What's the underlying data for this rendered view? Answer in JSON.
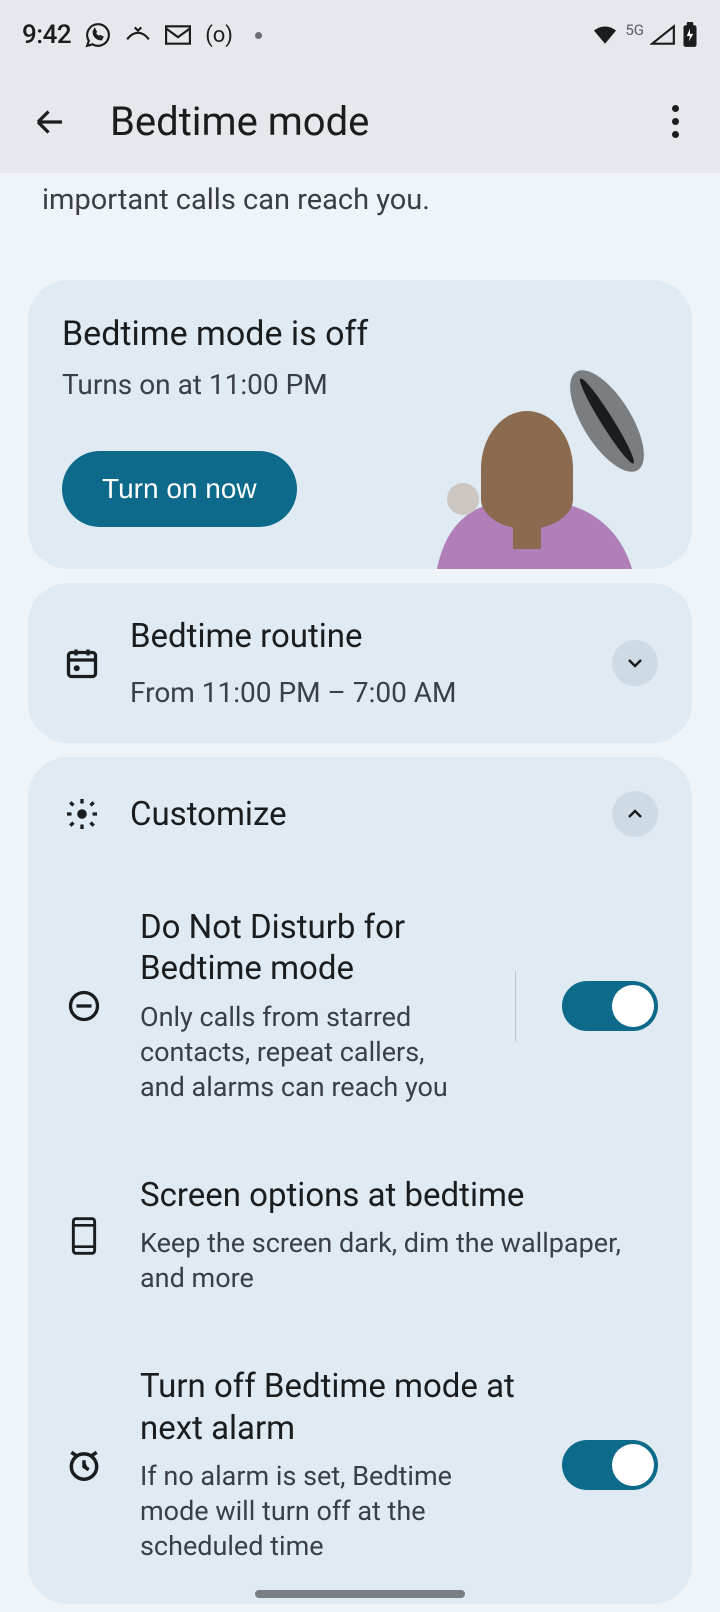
{
  "status_bar": {
    "time": "9:42",
    "network_label": "5G"
  },
  "app_bar": {
    "title": "Bedtime mode"
  },
  "intro": "important calls can reach you.",
  "status_card": {
    "title": "Bedtime mode is off",
    "subtitle": "Turns on at 11:00 PM",
    "button": "Turn on now"
  },
  "routine": {
    "title": "Bedtime routine",
    "subtitle": "From 11:00 PM – 7:00 AM"
  },
  "customize": {
    "title": "Customize",
    "options": {
      "dnd": {
        "title": "Do Not Disturb for Bedtime mode",
        "subtitle": "Only calls from starred contacts, repeat callers, and alarms can reach you",
        "on": true
      },
      "screen": {
        "title": "Screen options at bedtime",
        "subtitle": "Keep the screen dark, dim the wallpaper, and more"
      },
      "alarm_off": {
        "title": "Turn off Bedtime mode at next alarm",
        "subtitle": "If no alarm is set, Bedtime mode will turn off at the scheduled time",
        "on": true
      }
    }
  }
}
